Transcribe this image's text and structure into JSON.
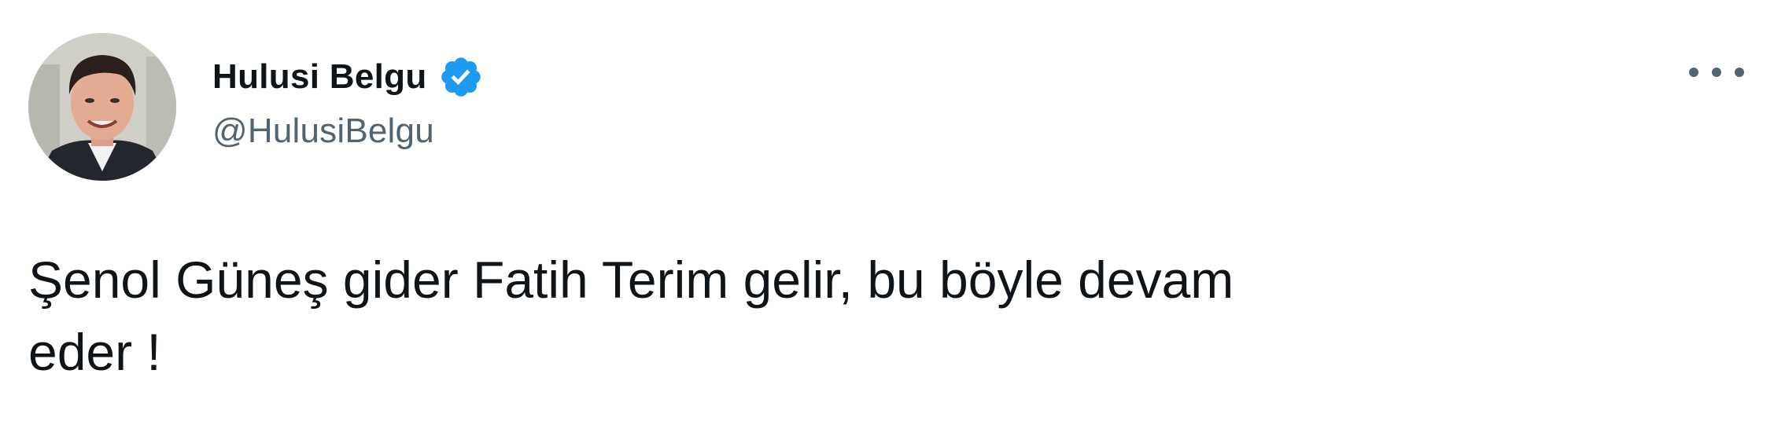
{
  "tweet": {
    "author": {
      "display_name": "Hulusi Belgu",
      "handle": "@HulusiBelgu",
      "verified": true,
      "avatar_icon": "profile-photo"
    },
    "more_icon": "more-options-icon",
    "text": "Şenol Güneş gider Fatih Terim gelir, bu böyle devam\neder !"
  },
  "colors": {
    "verified_badge": "#1d9bf0",
    "handle_text": "#536471",
    "body_text": "#0f1419",
    "background": "#ffffff"
  }
}
